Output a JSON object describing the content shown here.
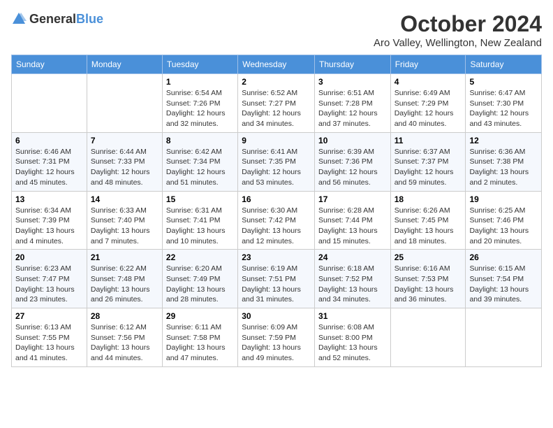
{
  "logo": {
    "general": "General",
    "blue": "Blue"
  },
  "title": "October 2024",
  "location": "Aro Valley, Wellington, New Zealand",
  "days_of_week": [
    "Sunday",
    "Monday",
    "Tuesday",
    "Wednesday",
    "Thursday",
    "Friday",
    "Saturday"
  ],
  "weeks": [
    [
      {
        "day": "",
        "info": ""
      },
      {
        "day": "",
        "info": ""
      },
      {
        "day": "1",
        "info": "Sunrise: 6:54 AM\nSunset: 7:26 PM\nDaylight: 12 hours and 32 minutes."
      },
      {
        "day": "2",
        "info": "Sunrise: 6:52 AM\nSunset: 7:27 PM\nDaylight: 12 hours and 34 minutes."
      },
      {
        "day": "3",
        "info": "Sunrise: 6:51 AM\nSunset: 7:28 PM\nDaylight: 12 hours and 37 minutes."
      },
      {
        "day": "4",
        "info": "Sunrise: 6:49 AM\nSunset: 7:29 PM\nDaylight: 12 hours and 40 minutes."
      },
      {
        "day": "5",
        "info": "Sunrise: 6:47 AM\nSunset: 7:30 PM\nDaylight: 12 hours and 43 minutes."
      }
    ],
    [
      {
        "day": "6",
        "info": "Sunrise: 6:46 AM\nSunset: 7:31 PM\nDaylight: 12 hours and 45 minutes."
      },
      {
        "day": "7",
        "info": "Sunrise: 6:44 AM\nSunset: 7:33 PM\nDaylight: 12 hours and 48 minutes."
      },
      {
        "day": "8",
        "info": "Sunrise: 6:42 AM\nSunset: 7:34 PM\nDaylight: 12 hours and 51 minutes."
      },
      {
        "day": "9",
        "info": "Sunrise: 6:41 AM\nSunset: 7:35 PM\nDaylight: 12 hours and 53 minutes."
      },
      {
        "day": "10",
        "info": "Sunrise: 6:39 AM\nSunset: 7:36 PM\nDaylight: 12 hours and 56 minutes."
      },
      {
        "day": "11",
        "info": "Sunrise: 6:37 AM\nSunset: 7:37 PM\nDaylight: 12 hours and 59 minutes."
      },
      {
        "day": "12",
        "info": "Sunrise: 6:36 AM\nSunset: 7:38 PM\nDaylight: 13 hours and 2 minutes."
      }
    ],
    [
      {
        "day": "13",
        "info": "Sunrise: 6:34 AM\nSunset: 7:39 PM\nDaylight: 13 hours and 4 minutes."
      },
      {
        "day": "14",
        "info": "Sunrise: 6:33 AM\nSunset: 7:40 PM\nDaylight: 13 hours and 7 minutes."
      },
      {
        "day": "15",
        "info": "Sunrise: 6:31 AM\nSunset: 7:41 PM\nDaylight: 13 hours and 10 minutes."
      },
      {
        "day": "16",
        "info": "Sunrise: 6:30 AM\nSunset: 7:42 PM\nDaylight: 13 hours and 12 minutes."
      },
      {
        "day": "17",
        "info": "Sunrise: 6:28 AM\nSunset: 7:44 PM\nDaylight: 13 hours and 15 minutes."
      },
      {
        "day": "18",
        "info": "Sunrise: 6:26 AM\nSunset: 7:45 PM\nDaylight: 13 hours and 18 minutes."
      },
      {
        "day": "19",
        "info": "Sunrise: 6:25 AM\nSunset: 7:46 PM\nDaylight: 13 hours and 20 minutes."
      }
    ],
    [
      {
        "day": "20",
        "info": "Sunrise: 6:23 AM\nSunset: 7:47 PM\nDaylight: 13 hours and 23 minutes."
      },
      {
        "day": "21",
        "info": "Sunrise: 6:22 AM\nSunset: 7:48 PM\nDaylight: 13 hours and 26 minutes."
      },
      {
        "day": "22",
        "info": "Sunrise: 6:20 AM\nSunset: 7:49 PM\nDaylight: 13 hours and 28 minutes."
      },
      {
        "day": "23",
        "info": "Sunrise: 6:19 AM\nSunset: 7:51 PM\nDaylight: 13 hours and 31 minutes."
      },
      {
        "day": "24",
        "info": "Sunrise: 6:18 AM\nSunset: 7:52 PM\nDaylight: 13 hours and 34 minutes."
      },
      {
        "day": "25",
        "info": "Sunrise: 6:16 AM\nSunset: 7:53 PM\nDaylight: 13 hours and 36 minutes."
      },
      {
        "day": "26",
        "info": "Sunrise: 6:15 AM\nSunset: 7:54 PM\nDaylight: 13 hours and 39 minutes."
      }
    ],
    [
      {
        "day": "27",
        "info": "Sunrise: 6:13 AM\nSunset: 7:55 PM\nDaylight: 13 hours and 41 minutes."
      },
      {
        "day": "28",
        "info": "Sunrise: 6:12 AM\nSunset: 7:56 PM\nDaylight: 13 hours and 44 minutes."
      },
      {
        "day": "29",
        "info": "Sunrise: 6:11 AM\nSunset: 7:58 PM\nDaylight: 13 hours and 47 minutes."
      },
      {
        "day": "30",
        "info": "Sunrise: 6:09 AM\nSunset: 7:59 PM\nDaylight: 13 hours and 49 minutes."
      },
      {
        "day": "31",
        "info": "Sunrise: 6:08 AM\nSunset: 8:00 PM\nDaylight: 13 hours and 52 minutes."
      },
      {
        "day": "",
        "info": ""
      },
      {
        "day": "",
        "info": ""
      }
    ]
  ]
}
